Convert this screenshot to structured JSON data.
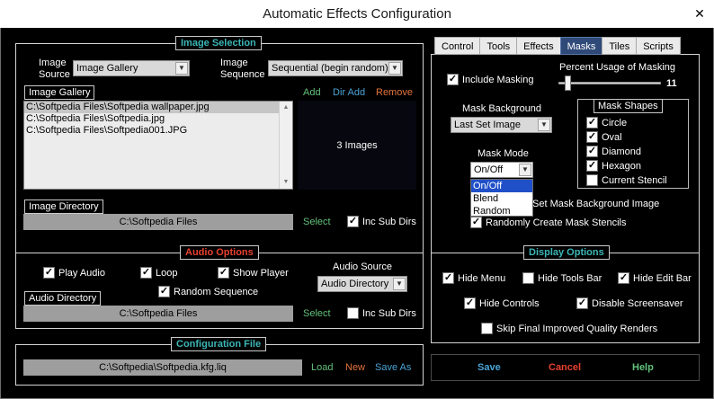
{
  "window": {
    "title": "Automatic Effects Configuration",
    "close_glyph": "✕"
  },
  "image_selection": {
    "title": "Image Selection",
    "image_source_label": "Image\nSource",
    "image_source_value": "Image Gallery",
    "image_sequence_label": "Image\nSequence",
    "image_sequence_value": "Sequential (begin random)",
    "gallery_label": "Image Gallery",
    "add": "Add",
    "dir_add": "Dir Add",
    "remove": "Remove",
    "files": [
      "C:\\Softpedia Files\\Softpedia wallpaper.jpg",
      "C:\\Softpedia Files\\Softpedia.jpg",
      "C:\\Softpedia Files\\Softpedia001.JPG"
    ],
    "image_count": "3 Images",
    "directory_label": "Image Directory",
    "directory_value": "C:\\Softpedia Files",
    "select": "Select",
    "inc_sub_dirs": "Inc Sub Dirs"
  },
  "audio": {
    "title": "Audio Options",
    "play_audio": "Play Audio",
    "loop": "Loop",
    "show_player": "Show Player",
    "random_sequence": "Random Sequence",
    "audio_source_label": "Audio Source",
    "audio_source_value": "Audio Directory",
    "directory_label": "Audio Directory",
    "directory_value": "C:\\Softpedia Files",
    "select": "Select",
    "inc_sub_dirs": "Inc Sub Dirs"
  },
  "config": {
    "title": "Configuration File",
    "path": "C:\\Softpedia\\Softpedia.kfg.liq",
    "load": "Load",
    "new": "New",
    "save_as": "Save As"
  },
  "tabs": [
    "Control",
    "Tools",
    "Effects",
    "Masks",
    "Tiles",
    "Scripts"
  ],
  "active_tab": "Masks",
  "masks": {
    "include_masking": "Include Masking",
    "percent_label": "Percent Usage of Masking",
    "percent_value": "11",
    "mask_background_label": "Mask Background",
    "mask_background_value": "Last Set Image",
    "mask_shapes_title": "Mask Shapes",
    "shapes": [
      "Circle",
      "Oval",
      "Diamond",
      "Hexagon",
      "Current Stencil"
    ],
    "mask_mode_label": "Mask Mode",
    "mask_mode_value": "On/Off",
    "mask_mode_options": [
      "On/Off",
      "Blend",
      "Random"
    ],
    "set_mask_bg_partial": "Set Mask Background Image",
    "random_stencils": "Randomly Create Mask Stencils"
  },
  "display": {
    "title": "Display Options",
    "hide_menu": "Hide Menu",
    "hide_tools_bar": "Hide Tools Bar",
    "hide_edit_bar": "Hide Edit Bar",
    "hide_controls": "Hide Controls",
    "disable_screensaver": "Disable Screensaver",
    "skip_renders": "Skip Final Improved Quality Renders"
  },
  "buttons": {
    "save": "Save",
    "cancel": "Cancel",
    "help": "Help"
  },
  "colors": {
    "section_title_teal": "#3cb5b5",
    "section_title_red": "#e8402f",
    "link_green": "#62c17a",
    "link_blue": "#4aa3d6",
    "link_orange": "#e5733b",
    "active_tab": "#2f4a78"
  }
}
